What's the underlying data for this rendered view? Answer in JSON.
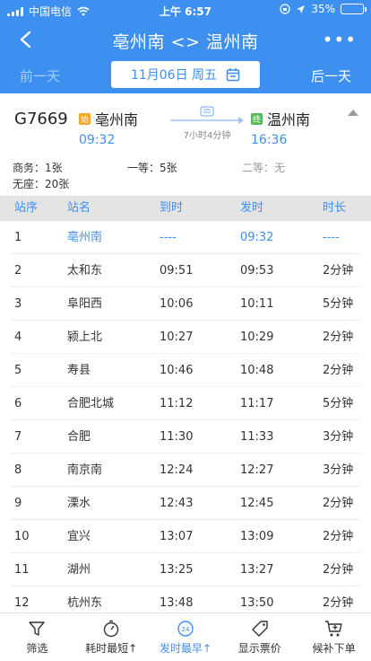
{
  "status_bar": {
    "carrier": "中国电信",
    "time": "上午 6:57",
    "battery": "35%",
    "battery_level": 0.35
  },
  "nav": {
    "title": "亳州南 <> 温州南"
  },
  "date_bar": {
    "prev_label": "前一天",
    "date": "11月06日 周五",
    "next_label": "后一天"
  },
  "train": {
    "number": "G7669",
    "from_tag": "始",
    "from_station": "亳州南",
    "from_time": "09:32",
    "to_tag": "终",
    "to_station": "温州南",
    "to_time": "16:36",
    "duration": "7小时4分钟"
  },
  "seats": [
    {
      "label": "商务：1张"
    },
    {
      "label": "一等：5张"
    },
    {
      "label": "二等：无"
    },
    {
      "label": "无座：20张"
    }
  ],
  "table": {
    "headers": [
      "站序",
      "站名",
      "到时",
      "发时",
      "时长"
    ],
    "rows": [
      [
        "1",
        "亳州南",
        "----",
        "09:32",
        "----"
      ],
      [
        "2",
        "太和东",
        "09:51",
        "09:53",
        "2分钟"
      ],
      [
        "3",
        "阜阳西",
        "10:06",
        "10:11",
        "5分钟"
      ],
      [
        "4",
        "颍上北",
        "10:27",
        "10:29",
        "2分钟"
      ],
      [
        "5",
        "寿县",
        "10:46",
        "10:48",
        "2分钟"
      ],
      [
        "6",
        "合肥北城",
        "11:12",
        "11:17",
        "5分钟"
      ],
      [
        "7",
        "合肥",
        "11:30",
        "11:33",
        "3分钟"
      ],
      [
        "8",
        "南京南",
        "12:24",
        "12:27",
        "3分钟"
      ],
      [
        "9",
        "溧水",
        "12:43",
        "12:45",
        "2分钟"
      ],
      [
        "10",
        "宜兴",
        "13:07",
        "13:09",
        "2分钟"
      ],
      [
        "11",
        "湖州",
        "13:25",
        "13:27",
        "2分钟"
      ],
      [
        "12",
        "杭州东",
        "13:48",
        "13:50",
        "2分钟"
      ]
    ]
  },
  "tabs": [
    {
      "label": "筛选",
      "icon": "filter-icon"
    },
    {
      "label": "耗时最短↑",
      "icon": "stopwatch-icon"
    },
    {
      "label": "发时最早↑",
      "icon": "clock-24-icon"
    },
    {
      "label": "显示票价",
      "icon": "price-tag-icon"
    },
    {
      "label": "候补下单",
      "icon": "cart-icon"
    }
  ],
  "colors": {
    "primary": "#3d8ff0",
    "start_tag": "#f5a623",
    "end_tag": "#5cb85c"
  }
}
